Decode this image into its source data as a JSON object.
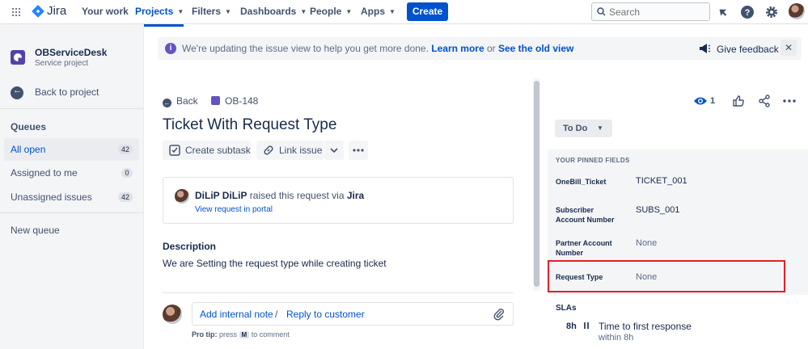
{
  "nav": {
    "logo_text": "Jira",
    "items": [
      {
        "label": "Your work"
      },
      {
        "label": "Projects"
      },
      {
        "label": "Filters"
      },
      {
        "label": "Dashboards"
      },
      {
        "label": "People"
      },
      {
        "label": "Apps"
      }
    ],
    "create_label": "Create",
    "search_placeholder": "Search"
  },
  "sidebar": {
    "project_name": "OBServiceDesk",
    "project_type": "Service project",
    "back_label": "Back to project",
    "queues_heading": "Queues",
    "queues": [
      {
        "label": "All open",
        "count": "42"
      },
      {
        "label": "Assigned to me",
        "count": "0"
      },
      {
        "label": "Unassigned issues",
        "count": "42"
      }
    ],
    "new_queue_label": "New queue"
  },
  "banner": {
    "text": "We're updating the issue view to help you get more done.",
    "learn_more": "Learn more",
    "or": "or",
    "old_view": "See the old view",
    "feedback_label": "Give feedback"
  },
  "issue": {
    "back_label": "Back",
    "key": "OB-148",
    "title": "Ticket With Request Type",
    "actions": {
      "create_subtask": "Create subtask",
      "link_issue": "Link issue"
    },
    "request": {
      "reporter": "DiLiP DiLiP",
      "raised_text": "raised this request via",
      "channel": "Jira",
      "portal_link": "View request in portal"
    },
    "description_heading": "Description",
    "description_text": "We are Setting the request type while creating ticket",
    "comment": {
      "internal_note": "Add internal note",
      "separator": "/",
      "reply": "Reply to customer",
      "protip_prefix": "Pro tip:",
      "protip_press": "press",
      "protip_key": "M",
      "protip_suffix": "to comment"
    }
  },
  "right_panel": {
    "watch_count": "1",
    "status": "To Do",
    "pinned_heading": "YOUR PINNED FIELDS",
    "fields": [
      {
        "name": "OneBill_Ticket",
        "value": "TICKET_001"
      },
      {
        "name": "Subscriber Account Number",
        "value": "SUBS_001"
      },
      {
        "name": "Partner Account Number",
        "value": "None"
      },
      {
        "name": "Request Type",
        "value": "None"
      }
    ],
    "slas_heading": "SLAs",
    "sla": {
      "time": "8h",
      "name": "Time to first response",
      "within": "within 8h"
    }
  },
  "colors": {
    "brand_blue": "#0052cc",
    "highlight_red": "#e2202a",
    "sidebar_bg": "#f4f5f7"
  }
}
